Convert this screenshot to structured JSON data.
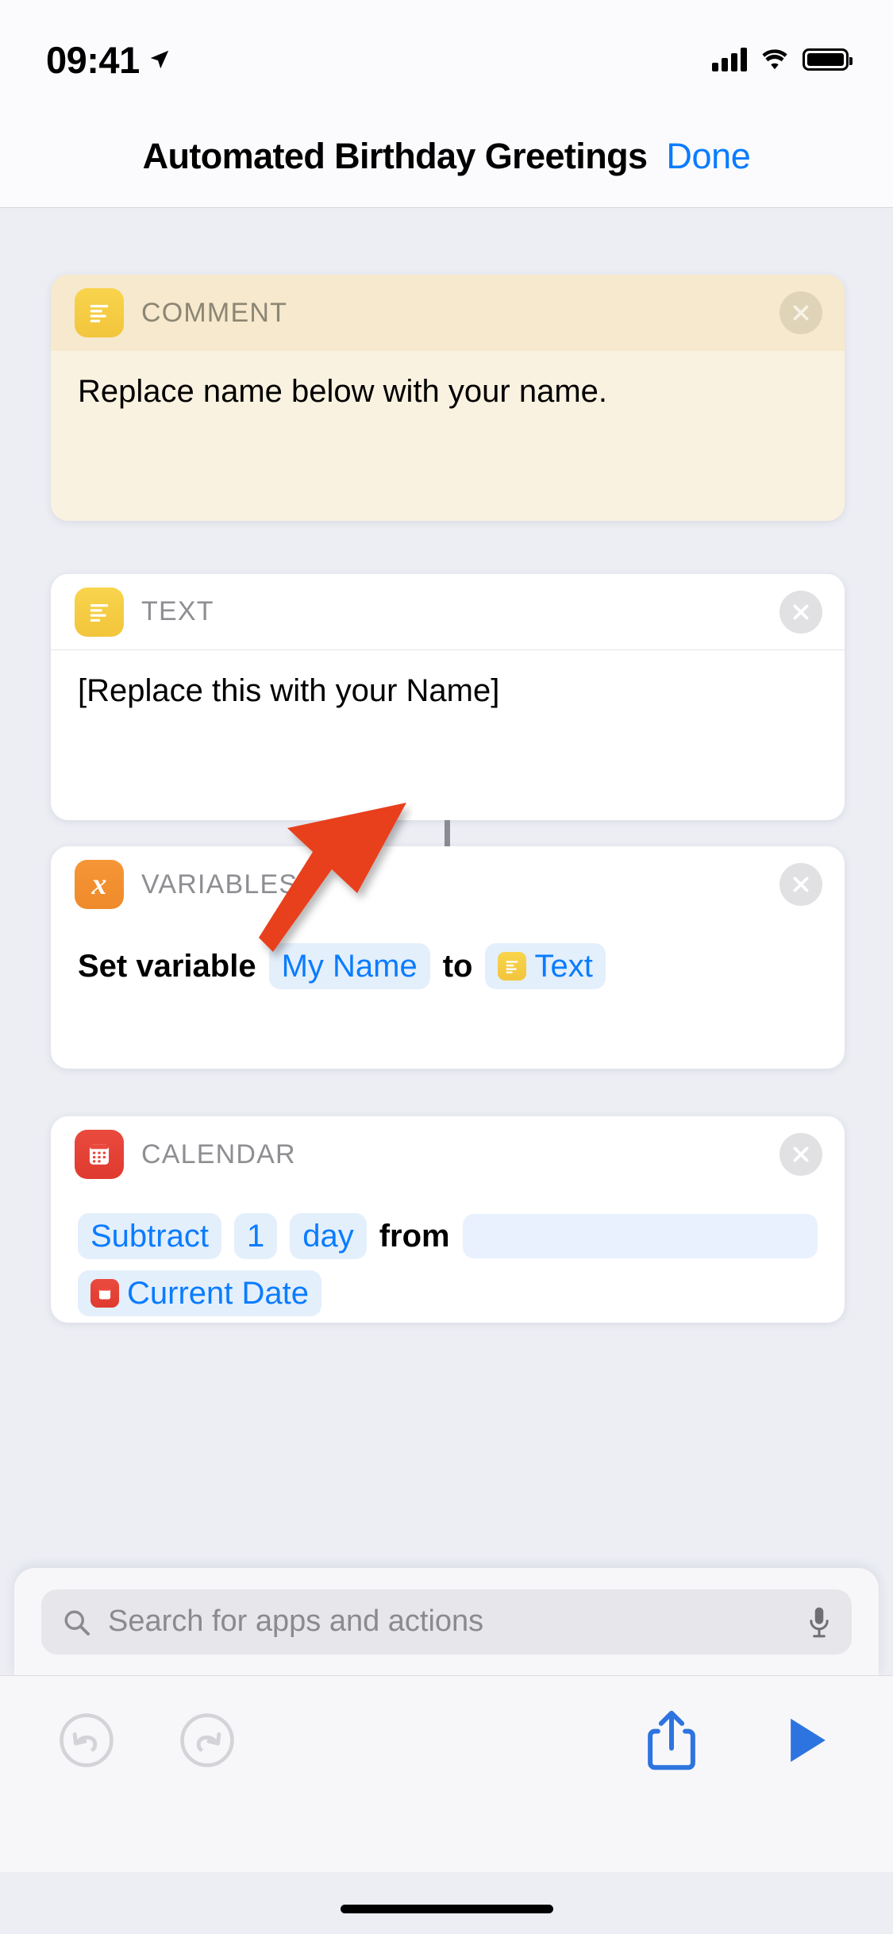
{
  "status_bar": {
    "time": "09:41",
    "location_icon": "location-arrow-icon",
    "signal_icon": "cellular-signal-icon",
    "wifi_icon": "wifi-icon",
    "battery_icon": "battery-full-icon"
  },
  "nav": {
    "title": "Automated Birthday Greetings",
    "done_label": "Done"
  },
  "colors": {
    "accent_blue": "#0a7cff",
    "comment_yellow": "#f8d44c",
    "variables_orange": "#f59637",
    "calendar_red": "#ea4a3e",
    "annotation_red": "#e8411f",
    "page_background": "#eceef4"
  },
  "actions": [
    {
      "kind": "COMMENT",
      "icon": "comment-lines-icon",
      "icon_color": "#f8d44c",
      "close_icon": "close-circle-icon",
      "body_text": "Replace name below with your name."
    },
    {
      "kind": "TEXT",
      "icon": "text-lines-icon",
      "icon_color": "#f8d44c",
      "close_icon": "close-circle-icon",
      "body_text": "[Replace this with your Name]"
    },
    {
      "kind": "VARIABLES",
      "icon": "variable-x-icon",
      "icon_color": "#f59637",
      "close_icon": "close-circle-icon",
      "body": {
        "prefix": "Set variable",
        "variable_name": "My Name",
        "middle": "to",
        "value_token": "Text",
        "value_token_icon": "text-lines-icon"
      }
    },
    {
      "kind": "CALENDAR",
      "icon": "calendar-icon",
      "icon_color": "#ea4a3e",
      "close_icon": "close-circle-icon",
      "body": {
        "operation": "Subtract",
        "amount": "1",
        "unit": "day",
        "connector": "from",
        "target_token": "Current Date",
        "target_token_icon": "calendar-icon"
      }
    }
  ],
  "annotation": {
    "type": "arrow",
    "color": "#e8411f",
    "points_to": "TEXT action body"
  },
  "search": {
    "placeholder": "Search for apps and actions",
    "search_icon": "search-icon",
    "mic_icon": "microphone-icon"
  },
  "toolbar": {
    "undo_icon": "undo-arrow-icon",
    "redo_icon": "redo-arrow-icon",
    "share_icon": "share-icon",
    "play_icon": "play-icon",
    "undo_enabled": "false",
    "redo_enabled": "false"
  },
  "home_indicator": "home-indicator"
}
